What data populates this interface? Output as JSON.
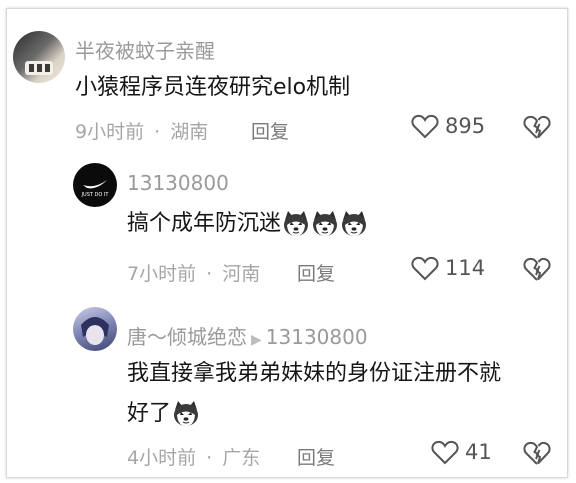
{
  "comments": [
    {
      "username": "半夜被蚊子亲醒",
      "text": "小猿程序员连夜研究elo机制",
      "time": "9小时前",
      "location": "湖南",
      "reply_label": "回复",
      "likes": "895"
    },
    {
      "username": "13130800",
      "avatar_label": "JUST DO IT",
      "text": "搞个成年防沉迷",
      "time": "7小时前",
      "location": "河南",
      "reply_label": "回复",
      "likes": "114"
    },
    {
      "username": "唐～倾城绝恋",
      "reply_to": "13130800",
      "text_line1": "我直接拿我弟弟妹妹的身份证注册不就",
      "text_line2": "好了",
      "time": "4小时前",
      "location": "广东",
      "reply_label": "回复",
      "likes": "41"
    }
  ],
  "separator": "·",
  "icons": {
    "like": "heart-outline-icon",
    "dislike": "broken-heart-icon",
    "emoji": "husky-dog-emoji"
  }
}
